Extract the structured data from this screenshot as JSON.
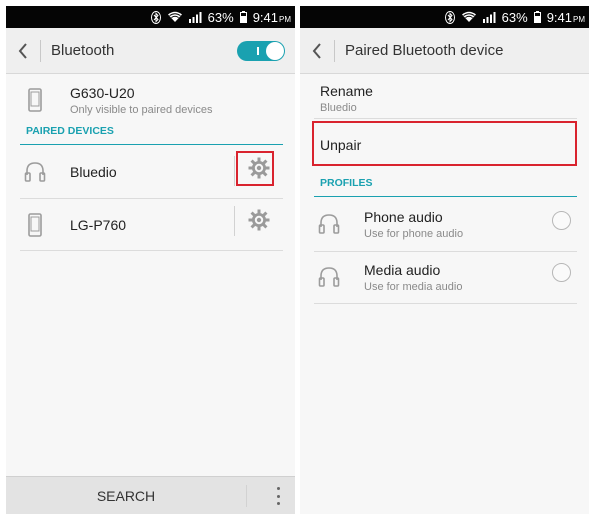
{
  "status_bar": {
    "battery_percent": "63%",
    "time": "9:41",
    "ampm": "PM",
    "icons": [
      "bluetooth-icon",
      "wifi-icon",
      "signal-icon",
      "battery-icon"
    ]
  },
  "left_screen": {
    "title": "Bluetooth",
    "bluetooth_enabled": true,
    "toggle_label": "I",
    "this_device": {
      "name": "G630-U20",
      "subtitle": "Only visible to paired devices",
      "icon": "phone-icon"
    },
    "paired_header": "PAIRED DEVICES",
    "paired_devices": [
      {
        "name": "Bluedio",
        "icon": "headphones-icon",
        "settings_icon": "gear-icon",
        "highlighted": true
      },
      {
        "name": "LG-P760",
        "icon": "phone-icon",
        "settings_icon": "gear-icon",
        "highlighted": false
      }
    ],
    "bottom": {
      "search_label": "SEARCH",
      "more_icon": "more-vertical-icon"
    }
  },
  "right_screen": {
    "title": "Paired Bluetooth device",
    "rename": {
      "label": "Rename",
      "value": "Bluedio"
    },
    "unpair_label": "Unpair",
    "unpair_highlighted": true,
    "profiles_header": "PROFILES",
    "profiles": [
      {
        "label": "Phone audio",
        "description": "Use for phone audio",
        "icon": "headphones-icon",
        "checked": false
      },
      {
        "label": "Media audio",
        "description": "Use for media audio",
        "icon": "headphones-icon",
        "checked": false
      }
    ]
  },
  "colors": {
    "accent": "#1aa1b0",
    "highlight_box": "#d9232e",
    "status_bar": "#050505"
  }
}
